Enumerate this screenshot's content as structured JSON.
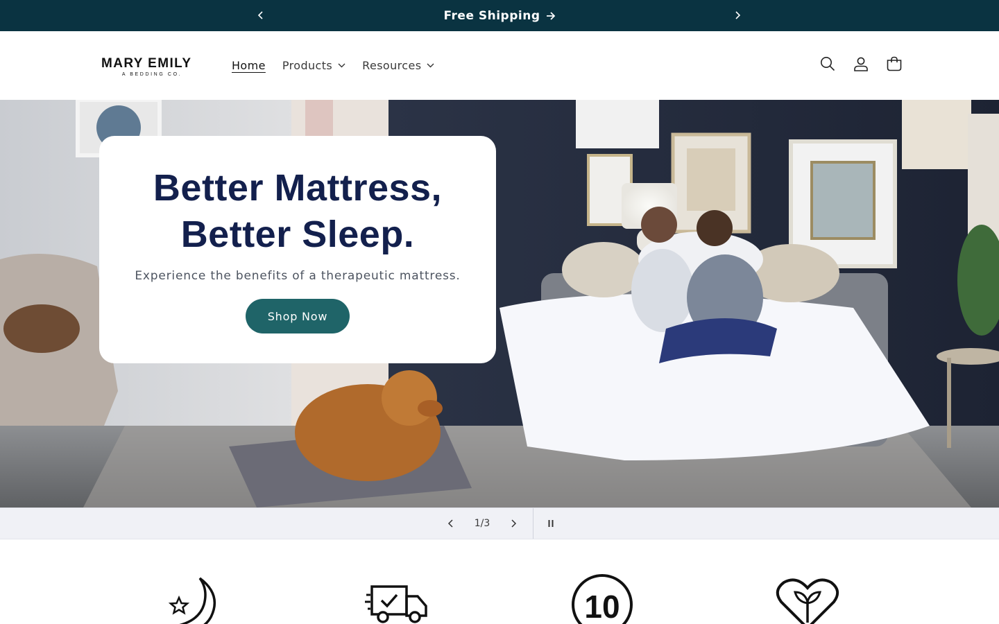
{
  "announcement": {
    "message": "Free Shipping",
    "arrow_icon": "arrow-right-icon",
    "prev_icon": "chevron-left-icon",
    "next_icon": "chevron-right-icon"
  },
  "header": {
    "logo": {
      "name": "MARY EMILY",
      "tagline": "A BEDDING CO."
    },
    "nav": [
      {
        "label": "Home",
        "active": true
      },
      {
        "label": "Products",
        "dropdown": true
      },
      {
        "label": "Resources",
        "dropdown": true
      }
    ],
    "icons": [
      "search-icon",
      "account-icon",
      "cart-icon"
    ]
  },
  "hero": {
    "title_line1": "Better Mattress,",
    "title_line2": "Better Sleep.",
    "subtitle": "Experience the benefits of a therapeutic mattress.",
    "cta_label": "Shop Now"
  },
  "slider": {
    "counter": "1/3",
    "current": 1,
    "total": 3
  },
  "features": {
    "icons": [
      "moon-star-icon",
      "delivery-truck-icon",
      "ten-year-icon",
      "heart-plant-icon"
    ],
    "ten_label": "10"
  },
  "colors": {
    "announcement_bg": "#0a3341",
    "headline": "#13204d",
    "button_bg": "#1f6468",
    "slider_bar": "#f0f1f6"
  }
}
